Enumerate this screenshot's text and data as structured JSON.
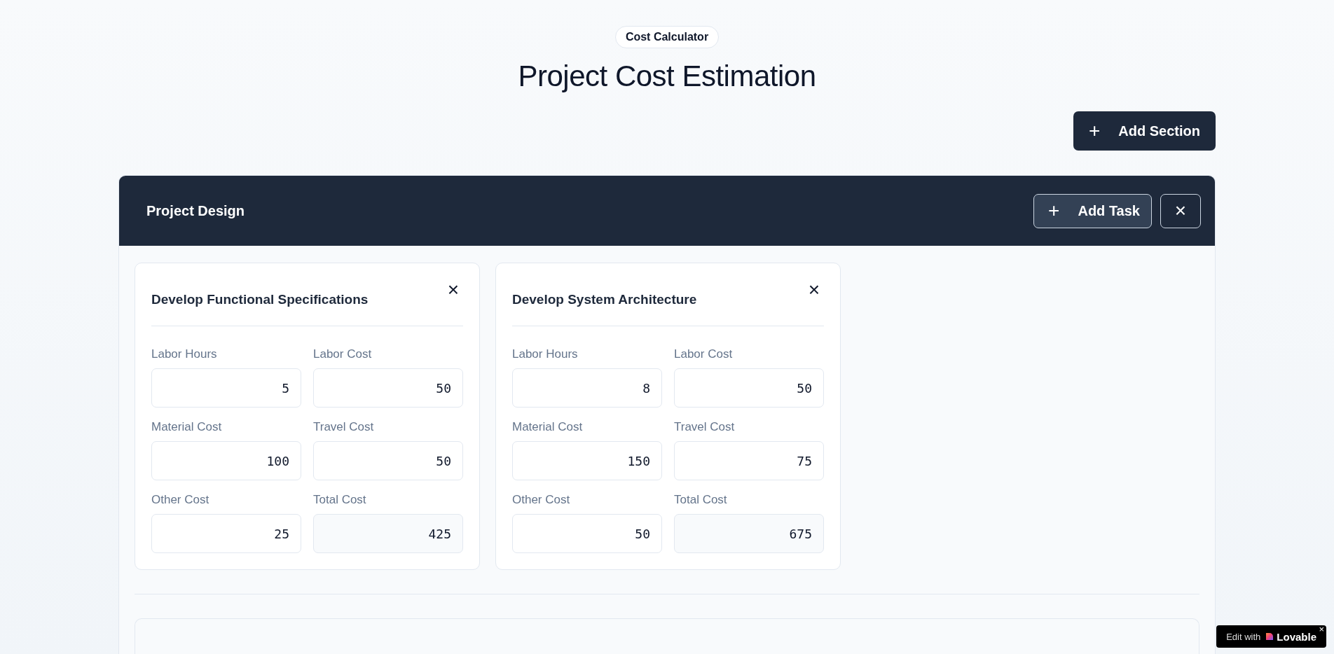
{
  "badge": "Cost Calculator",
  "title": "Project Cost Estimation",
  "add_section_button": {
    "icon": "+",
    "label": "Add Section"
  },
  "sections": [
    {
      "title": "Project Design",
      "add_task_button": {
        "icon": "+",
        "label": "Add Task"
      },
      "close_button": "×",
      "tasks": [
        {
          "title": "Develop Functional Specifications",
          "close_button": "×",
          "fields": [
            {
              "label": "Labor Hours",
              "value": "5",
              "kind": "input"
            },
            {
              "label": "Labor Cost",
              "value": "50",
              "kind": "input"
            },
            {
              "label": "Material Cost",
              "value": "100",
              "kind": "input"
            },
            {
              "label": "Travel Cost",
              "value": "50",
              "kind": "input"
            },
            {
              "label": "Other Cost",
              "value": "25",
              "kind": "input"
            },
            {
              "label": "Total Cost",
              "value": "425",
              "kind": "computed"
            }
          ]
        },
        {
          "title": "Develop System Architecture",
          "close_button": "×",
          "fields": [
            {
              "label": "Labor Hours",
              "value": "8",
              "kind": "input"
            },
            {
              "label": "Labor Cost",
              "value": "50",
              "kind": "input"
            },
            {
              "label": "Material Cost",
              "value": "150",
              "kind": "input"
            },
            {
              "label": "Travel Cost",
              "value": "75",
              "kind": "input"
            },
            {
              "label": "Other Cost",
              "value": "50",
              "kind": "input"
            },
            {
              "label": "Total Cost",
              "value": "675",
              "kind": "computed"
            }
          ]
        }
      ]
    }
  ],
  "edit_badge": {
    "prefix": "Edit with",
    "brand": "Lovable",
    "close": "×"
  }
}
